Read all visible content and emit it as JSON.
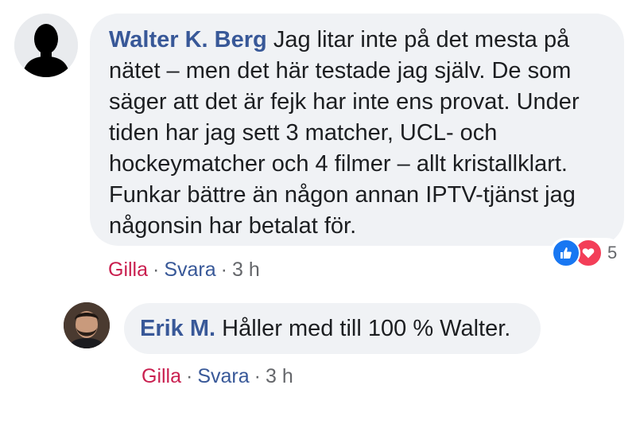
{
  "comment": {
    "author": "Walter K. Berg",
    "text_lines": [
      "Jag litar inte på det mesta på",
      "nätet – men det här testade jag själv. De som",
      "säger att det är fejk har inte ens provat. Under",
      "tiden har jag sett 3 matcher, UCL- och",
      "hockeymatcher och 4 filmer – allt kristallklart.",
      "Funkar bättre än någon annan IPTV-tjänst jag",
      "någonsin har betalat för."
    ],
    "reactions": {
      "icons": [
        "like-icon",
        "love-icon"
      ],
      "count": "5"
    },
    "actions": {
      "like": "Gilla",
      "separator": "·",
      "reply": "Svara",
      "time": "3 h"
    }
  },
  "reply": {
    "author": "Erik M.",
    "text": "Håller med till 100 % Walter.",
    "actions": {
      "like": "Gilla",
      "separator": "·",
      "reply": "Svara",
      "time": "3 h"
    }
  },
  "colors": {
    "author": "#385898",
    "like_link": "#c91f4f",
    "reply_link": "#385898",
    "meta": "#65676b",
    "bubble": "#f0f2f5",
    "like_reaction": "#1877f2",
    "love_reaction": "#f33e58"
  }
}
